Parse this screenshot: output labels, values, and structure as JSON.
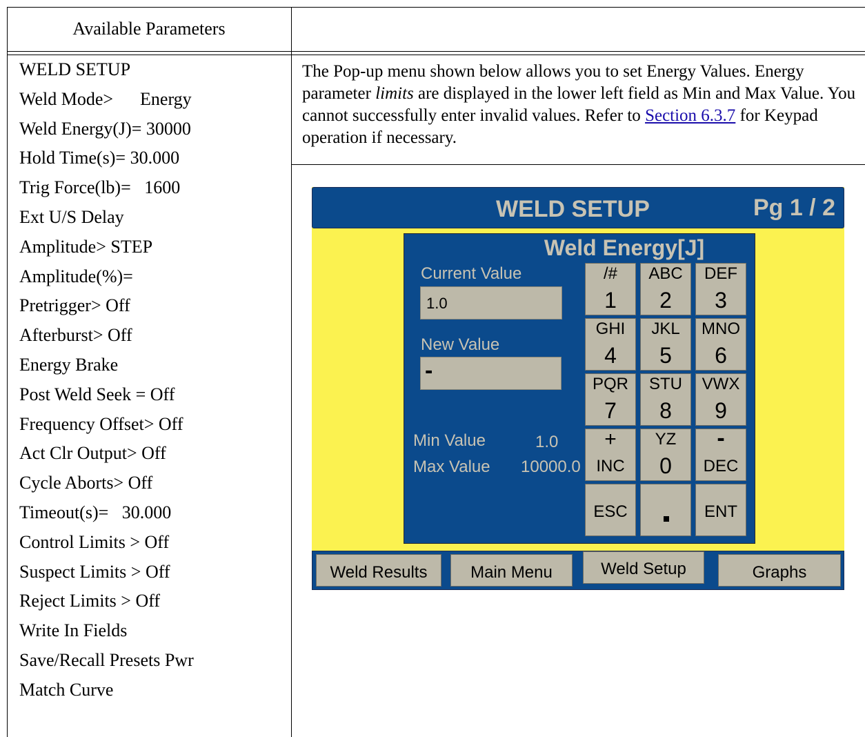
{
  "table": {
    "left_header": "Available Parameters"
  },
  "parameters": [
    "WELD SETUP",
    "Weld Mode>      Energy",
    "Weld Energy(J)= 30000",
    "Hold Time(s)= 30.000",
    "Trig Force(lb)=   1600",
    "Ext U/S Delay",
    "Amplitude> STEP",
    "Amplitude(%)=",
    "Pretrigger> Off",
    "Afterburst> Off",
    "Energy Brake",
    "Post Weld Seek = Off",
    "Frequency Offset> Off",
    "Act Clr Output> Off",
    "Cycle Aborts> Off",
    "Timeout(s)=   30.000",
    "Control Limits > Off",
    "Suspect Limits > Off",
    "Reject Limits > Off",
    "Write In Fields",
    "Save/Recall Presets Pwr",
    "Match Curve"
  ],
  "description": {
    "part1": "The Pop-up menu shown below allows you to set Energy Values. Energy parameter ",
    "emphasis": "limits",
    "part2": " are displayed in the lower left field as Min and Max Value. You cannot successfully enter invalid values. Refer to ",
    "link": "Section 6.3.7",
    "part3": " for Keypad operation if necessary."
  },
  "screen": {
    "title": "WELD SETUP",
    "page": "Pg 1 / 2",
    "popup": {
      "title": "Weld Energy[J]",
      "current_label": "Current Value",
      "current_value": "1.0",
      "new_label": "New Value",
      "new_value": "-",
      "min_label": "Min Value",
      "min_value": "1.0",
      "max_label": "Max Value",
      "max_value": "10000.0"
    },
    "keys": [
      {
        "top": "/#",
        "bottom": "1"
      },
      {
        "top": "ABC",
        "bottom": "2"
      },
      {
        "top": "DEF",
        "bottom": "3"
      },
      {
        "top": "GHI",
        "bottom": "4"
      },
      {
        "top": "JKL",
        "bottom": "5"
      },
      {
        "top": "MNO",
        "bottom": "6"
      },
      {
        "top": "PQR",
        "bottom": "7"
      },
      {
        "top": "STU",
        "bottom": "8"
      },
      {
        "top": "VWX",
        "bottom": "9"
      },
      {
        "top": "+",
        "bottom": "INC"
      },
      {
        "top": "YZ",
        "bottom": "0"
      },
      {
        "top": "-",
        "bottom": "DEC"
      },
      {
        "label": "ESC"
      },
      {
        "label": "."
      },
      {
        "label": "ENT"
      }
    ],
    "nav": [
      "Weld Results",
      "Main Menu",
      "Weld Setup",
      "Graphs"
    ],
    "colors": {
      "screen_bg": "#fbf250",
      "panel_blue": "#0b4a8c",
      "button_gray": "#bdb9a9",
      "label_text": "#c8c3b3"
    }
  }
}
